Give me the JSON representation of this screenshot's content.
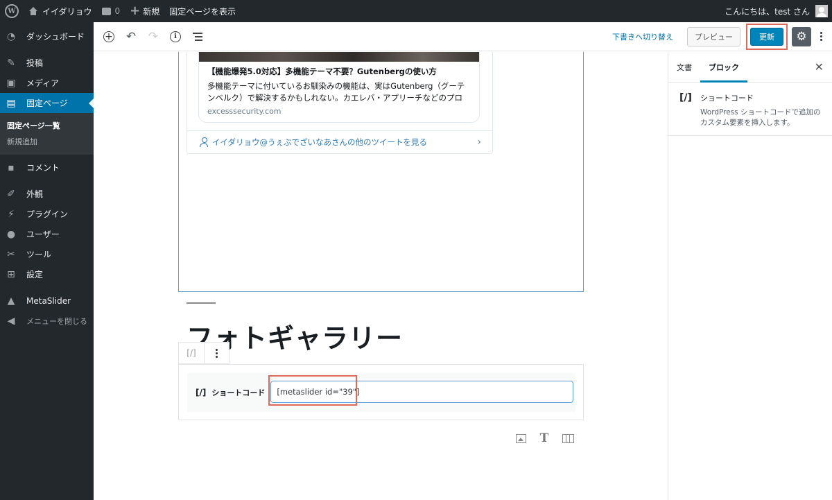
{
  "adminbar": {
    "site_name": "イイダリョウ",
    "comments_count": "0",
    "new_label": "新規",
    "view_page": "固定ページを表示",
    "greeting": "こんにちは、test さん"
  },
  "sidebar": {
    "items": [
      {
        "label": "ダッシュボード",
        "icon": "dashboard-icon"
      },
      {
        "label": "投稿",
        "icon": "pin-icon"
      },
      {
        "label": "メディア",
        "icon": "media-icon"
      },
      {
        "label": "固定ページ",
        "icon": "page-icon"
      },
      {
        "label": "コメント",
        "icon": "comment-icon"
      },
      {
        "label": "外観",
        "icon": "brush-icon"
      },
      {
        "label": "プラグイン",
        "icon": "plugin-icon"
      },
      {
        "label": "ユーザー",
        "icon": "user-icon"
      },
      {
        "label": "ツール",
        "icon": "wrench-icon"
      },
      {
        "label": "設定",
        "icon": "settings-icon"
      },
      {
        "label": "MetaSlider",
        "icon": "metaslider-icon"
      }
    ],
    "submenu": [
      "固定ページ一覧",
      "新規追加"
    ],
    "collapse": "メニューを閉じる"
  },
  "toolbar": {
    "draft": "下書きへ切り替え",
    "preview": "プレビュー",
    "update": "更新"
  },
  "tweet": {
    "card_title": "【機能爆発5.0対応】多機能テーマ不要？Gutenbergの使い方",
    "card_desc": "多機能テーマに付いているお馴染みの機能は、実はGutenberg（グーテンベルク）で解決するかもしれない。カエレバ・アプリーチなどのプロ",
    "card_domain": "excesssecurity.com",
    "more_link": "イイダリョウ@うぇぶでざいなあさんの他のツイートを見る"
  },
  "content": {
    "heading": "フォトギャラリー"
  },
  "shortcode": {
    "icon_text": "[/]",
    "label": "ショートコード",
    "value": "[metaslider id=\"39\"]"
  },
  "settings": {
    "tab_document": "文書",
    "tab_block": "ブロック",
    "block_icon": "[/]",
    "block_name": "ショートコード",
    "block_desc": "WordPress ショートコードで追加のカスタム要素を挿入します。"
  },
  "colors": {
    "admin_bg": "#23282d",
    "accent": "#0073aa",
    "update_button": "#0085ba",
    "highlight_box": "#e06a5a"
  }
}
